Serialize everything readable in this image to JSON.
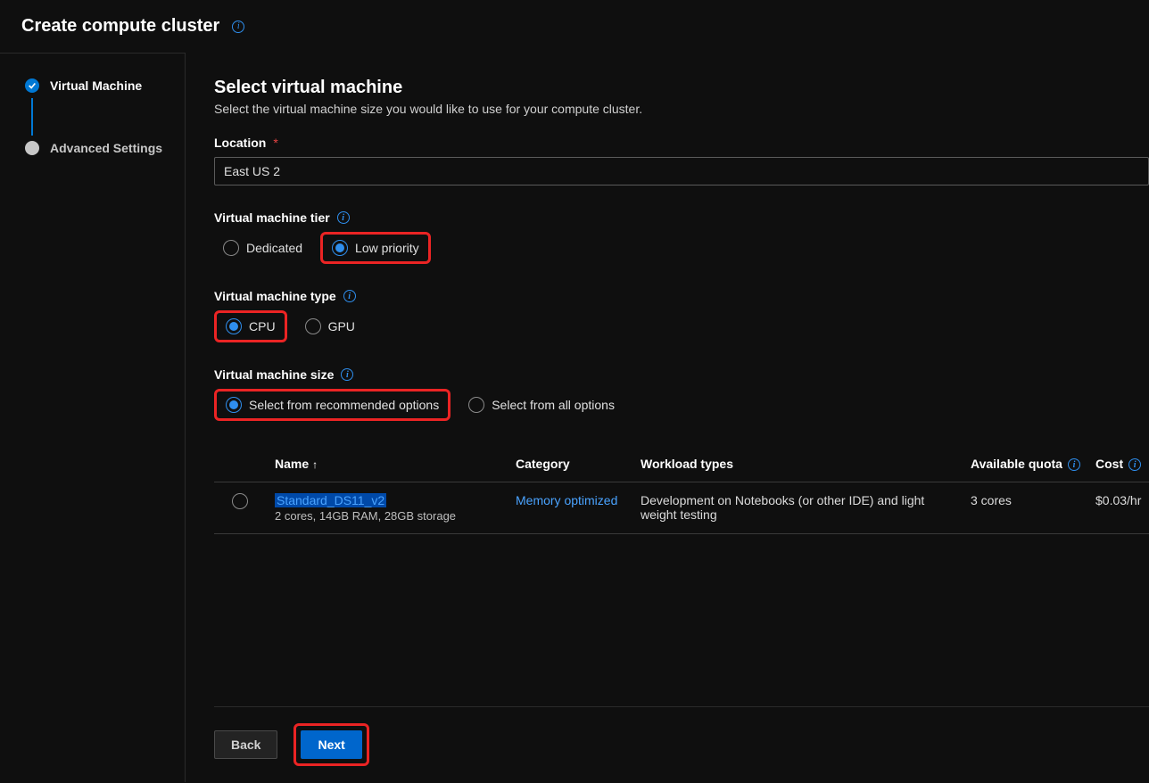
{
  "header": {
    "title": "Create compute cluster"
  },
  "steps": {
    "vm": "Virtual Machine",
    "advanced": "Advanced Settings"
  },
  "main": {
    "heading": "Select virtual machine",
    "subtitle": "Select the virtual machine size you would like to use for your compute cluster.",
    "location_label": "Location",
    "location_value": "East US 2",
    "tier_label": "Virtual machine tier",
    "tier_options": {
      "dedicated": "Dedicated",
      "low": "Low priority"
    },
    "type_label": "Virtual machine type",
    "type_options": {
      "cpu": "CPU",
      "gpu": "GPU"
    },
    "size_label": "Virtual machine size",
    "size_options": {
      "rec": "Select from recommended options",
      "all": "Select from all options"
    }
  },
  "table": {
    "headers": {
      "name": "Name",
      "category": "Category",
      "workload": "Workload types",
      "quota": "Available quota",
      "cost": "Cost"
    },
    "rows": [
      {
        "name": "Standard_DS11_v2",
        "specs": "2 cores, 14GB RAM, 28GB storage",
        "category": "Memory optimized",
        "workload": "Development on Notebooks (or other IDE) and light weight testing",
        "quota": "3 cores",
        "cost": "$0.03/hr"
      }
    ]
  },
  "footer": {
    "back": "Back",
    "next": "Next"
  }
}
